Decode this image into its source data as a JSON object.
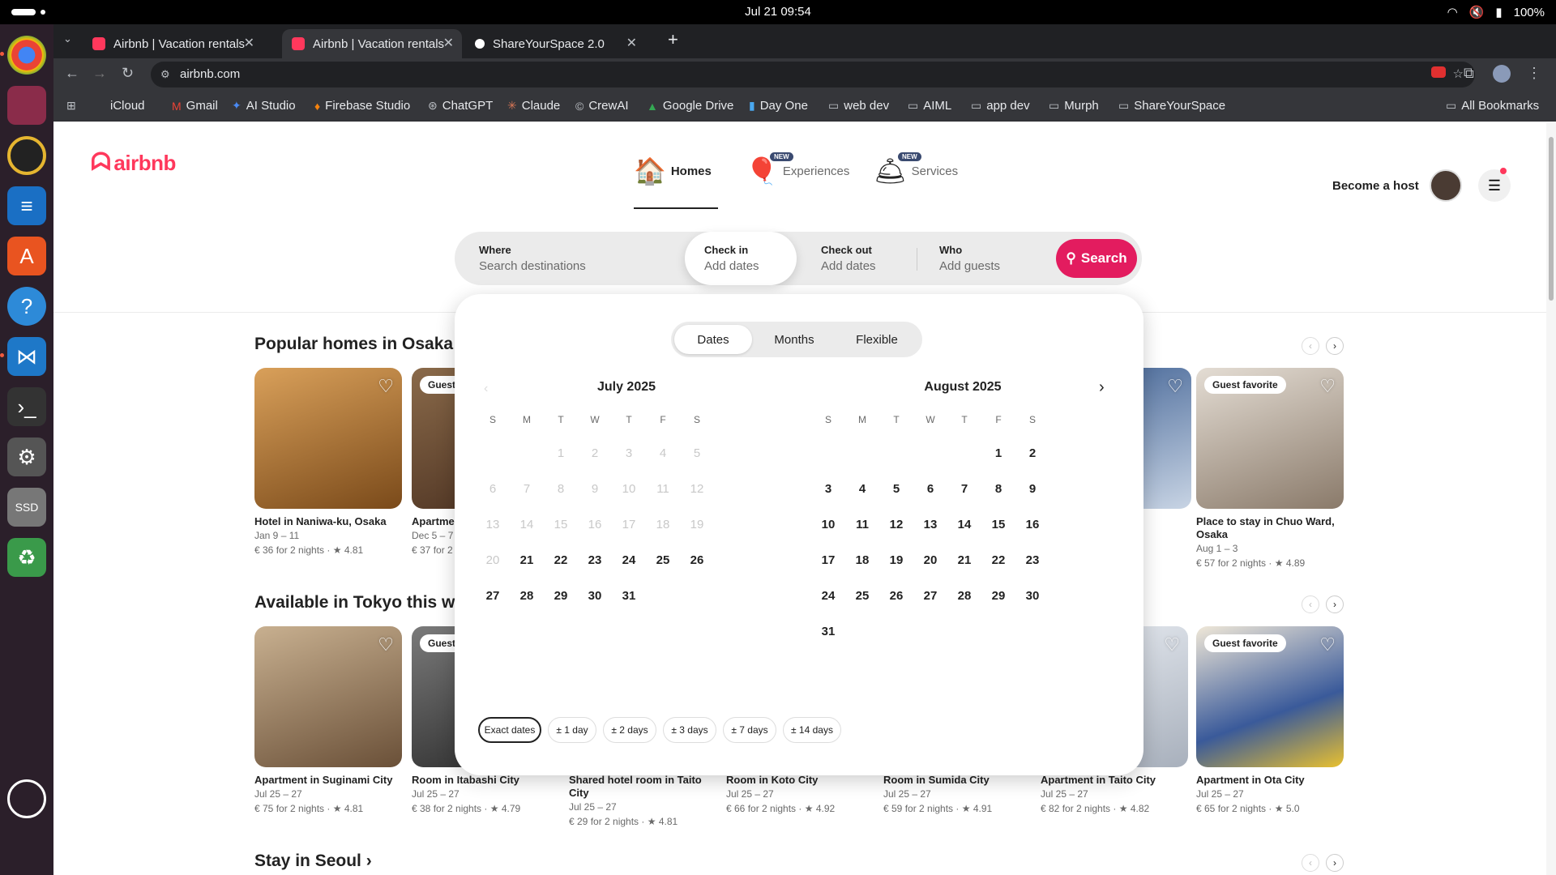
{
  "system": {
    "clock": "Jul 21  09:54",
    "battery": "100%"
  },
  "browser": {
    "tabs": [
      {
        "title": "Airbnb | Vacation rentals",
        "color": "#ff385c"
      },
      {
        "title": "Airbnb | Vacation rentals",
        "color": "#ff385c"
      },
      {
        "title": "ShareYourSpace 2.0",
        "color": "#ffffff"
      }
    ],
    "url": "airbnb.com",
    "bookmarks": [
      "iCloud",
      "Gmail",
      "AI Studio",
      "Firebase Studio",
      "ChatGPT",
      "Claude",
      "CrewAI",
      "Google Drive",
      "Day One",
      "web dev",
      "AIML",
      "app dev",
      "Murph",
      "ShareYourSpace"
    ],
    "all_bookmarks": "All Bookmarks"
  },
  "header": {
    "logo": "airbnb",
    "categories": [
      {
        "label": "Homes",
        "icon": "house-icon"
      },
      {
        "label": "Experiences",
        "icon": "balloon-icon",
        "badge": "NEW"
      },
      {
        "label": "Services",
        "icon": "bell-icon",
        "badge": "NEW"
      }
    ],
    "become_host": "Become a host"
  },
  "search": {
    "where_label": "Where",
    "where_placeholder": "Search destinations",
    "checkin_label": "Check in",
    "checkin_value": "Add dates",
    "checkout_label": "Check out",
    "checkout_value": "Add dates",
    "who_label": "Who",
    "who_value": "Add guests",
    "button": "Search"
  },
  "calendar": {
    "modes": [
      "Dates",
      "Months",
      "Flexible"
    ],
    "selected_mode": "Dates",
    "weekdays": [
      "S",
      "M",
      "T",
      "W",
      "T",
      "F",
      "S"
    ],
    "months": [
      {
        "title": "July 2025",
        "first_weekday": 2,
        "days": 31,
        "past_until": 20
      },
      {
        "title": "August 2025",
        "first_weekday": 5,
        "days": 31,
        "past_until": 0
      }
    ],
    "flex_chips": [
      "Exact dates",
      "± 1 day",
      "± 2 days",
      "± 3 days",
      "± 7 days",
      "± 14 days"
    ]
  },
  "sections": [
    {
      "title": "Popular homes in Osaka ›",
      "cards": [
        {
          "title": "Hotel in Naniwa-ku, Osaka",
          "dates": "Jan 9 – 11",
          "price": "€ 36 for 2 nights · ★ 4.81",
          "badge": "",
          "color": "#8a5a2a"
        },
        {
          "title": "Apartme",
          "dates": "Dec 5 – 7",
          "price": "€ 37 for 2",
          "badge": "Guest",
          "color": "#6b4a30"
        },
        {
          "title": "Place to stay in Chuo Ward, Osaka",
          "dates": "Aug 1 – 3",
          "price": "€ 57 for 2 nights · ★ 4.89",
          "badge": "Guest favorite",
          "color": "#b8aea4"
        }
      ]
    },
    {
      "title": "Available in Tokyo this wee",
      "cards": [
        {
          "title": "Apartment in Suginami City",
          "dates": "Jul 25 – 27",
          "price": "€ 75 for 2 nights · ★ 4.81",
          "badge": "",
          "color": "#a08468"
        },
        {
          "title": "Room in Itabashi City",
          "dates": "Jul 25 – 27",
          "price": "€ 38 for 2 nights · ★ 4.79",
          "badge": "Guest",
          "color": "#5a5a5a"
        },
        {
          "title": "Shared hotel room in Taito City",
          "dates": "Jul 25 – 27",
          "price": "€ 29 for 2 nights · ★ 4.81",
          "badge": "",
          "color": ""
        },
        {
          "title": "Room in Koto City",
          "dates": "Jul 25 – 27",
          "price": "€ 66 for 2 nights · ★ 4.92",
          "badge": "",
          "color": ""
        },
        {
          "title": "Room in Sumida City",
          "dates": "Jul 25 – 27",
          "price": "€ 59 for 2 nights · ★ 4.91",
          "badge": "",
          "color": ""
        },
        {
          "title": "Apartment in Taito City",
          "dates": "Jul 25 – 27",
          "price": "€ 82 for 2 nights · ★ 4.82",
          "badge": "",
          "color": "#c8ccd4"
        },
        {
          "title": "Apartment in Ota City",
          "dates": "Jul 25 – 27",
          "price": "€ 65 for 2 nights · ★ 5.0",
          "badge": "Guest favorite",
          "color": "#3a5a9a"
        }
      ]
    },
    {
      "title": "Stay in Seoul ›",
      "cards": []
    }
  ]
}
